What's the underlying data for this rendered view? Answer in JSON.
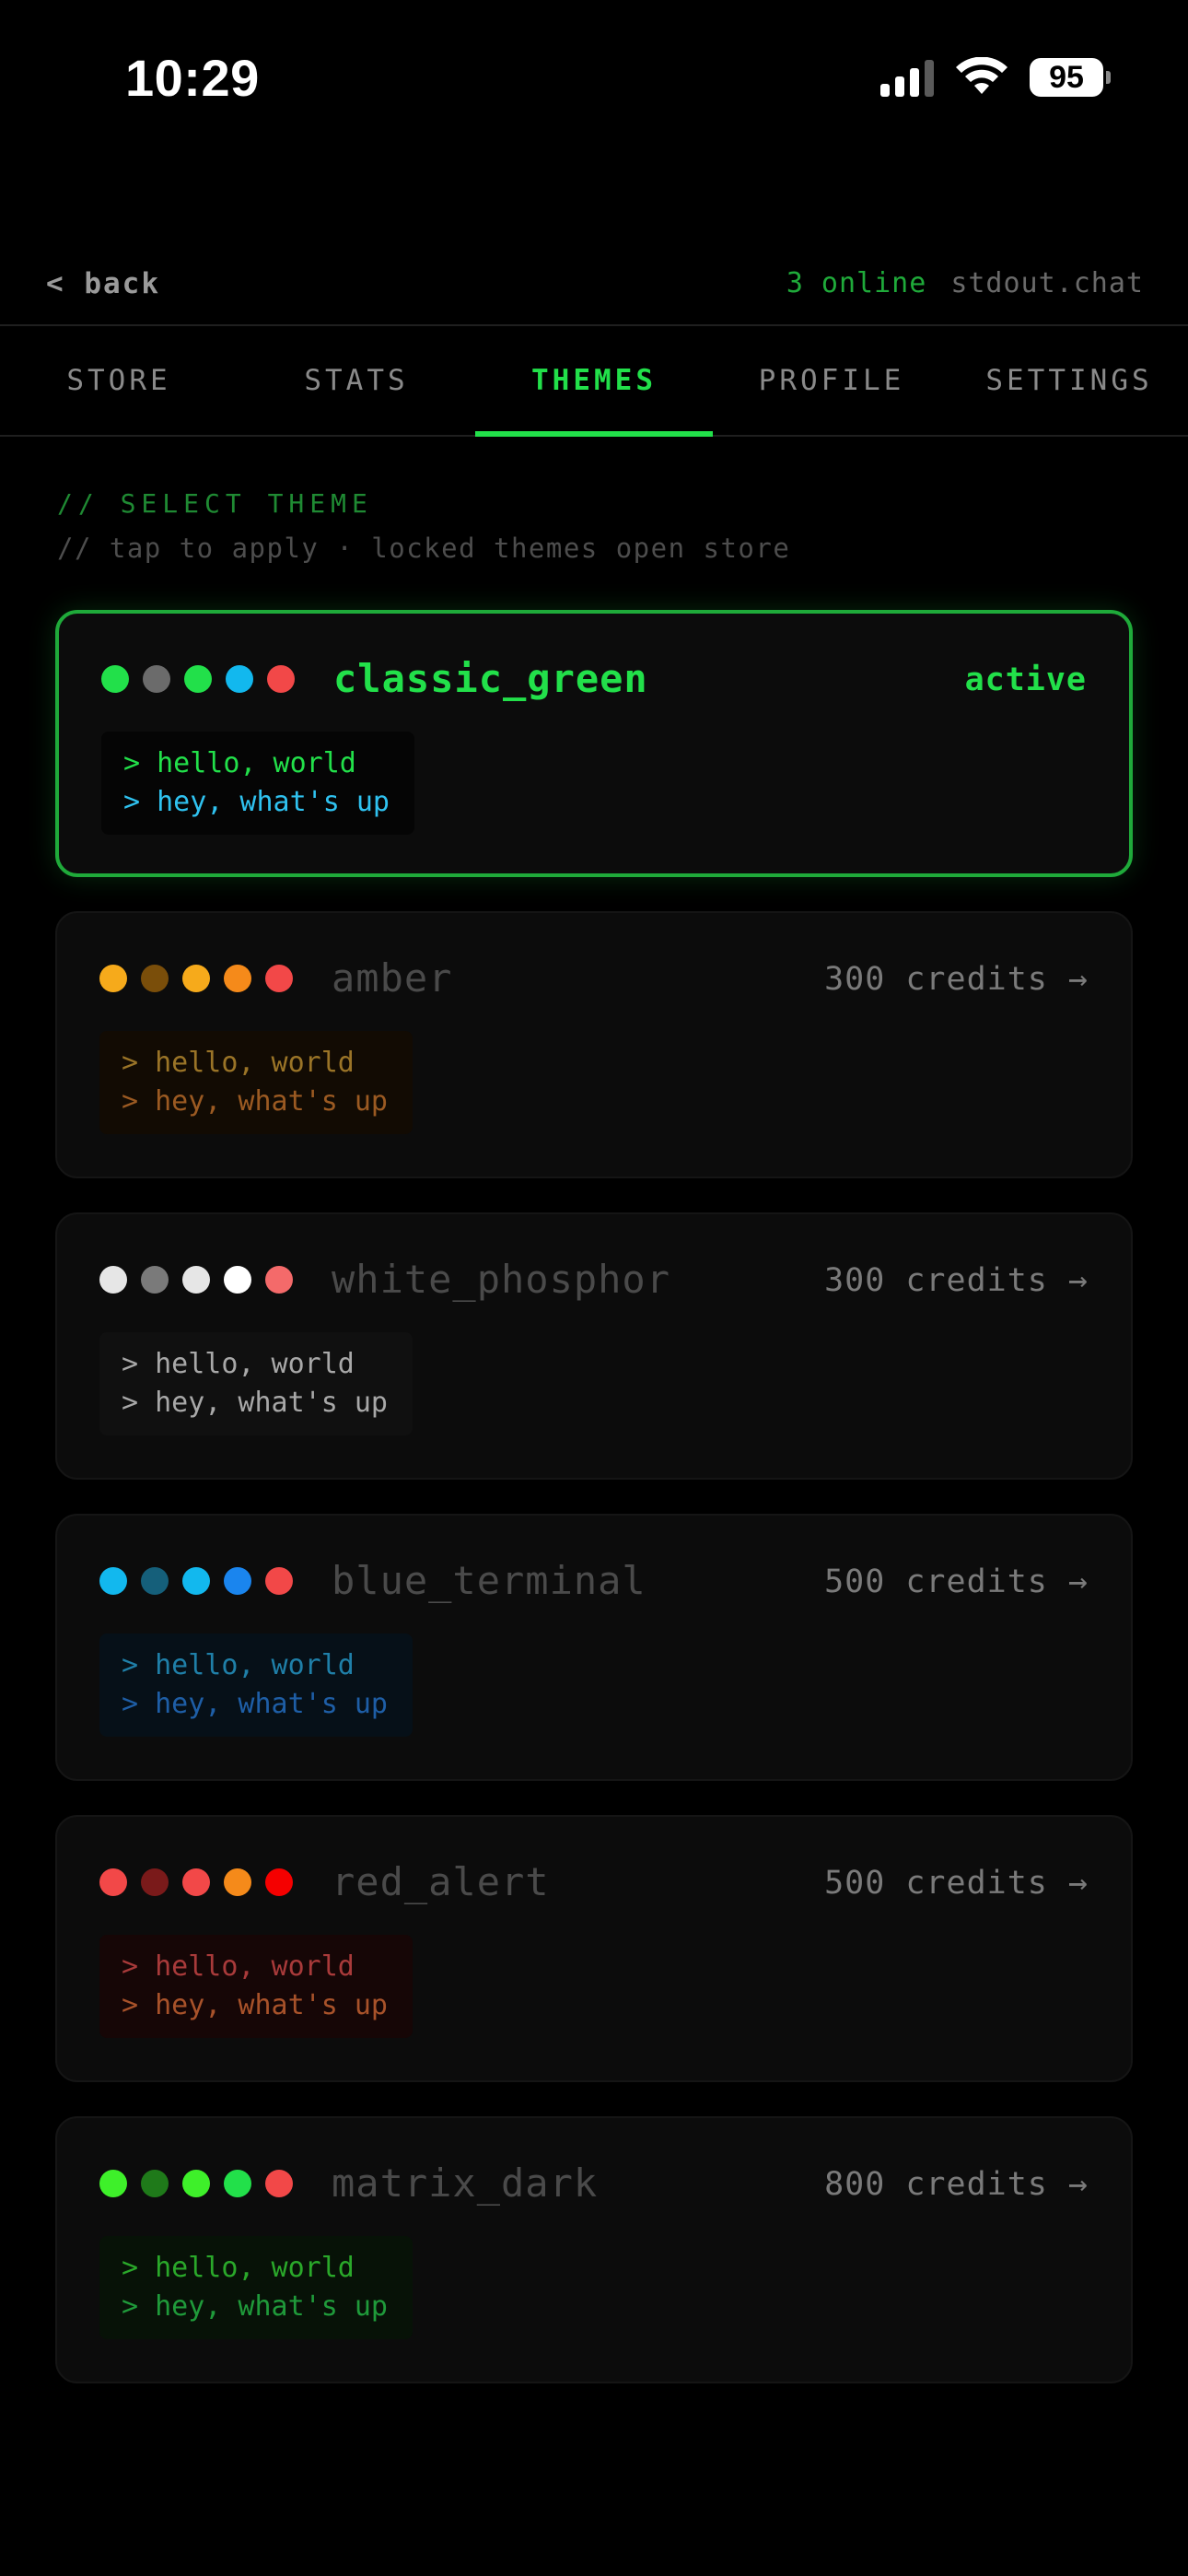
{
  "status": {
    "time": "10:29",
    "battery": "95"
  },
  "nav": {
    "back_label": "< back",
    "online": "3 online",
    "site": "stdout.chat"
  },
  "tabs": [
    {
      "label": "STORE",
      "active": false
    },
    {
      "label": "STATS",
      "active": false
    },
    {
      "label": "THEMES",
      "active": true
    },
    {
      "label": "PROFILE",
      "active": false
    },
    {
      "label": "SETTINGS",
      "active": false
    }
  ],
  "section": {
    "title": "// SELECT THEME",
    "subtitle": "// tap to apply · locked themes open store"
  },
  "themes": [
    {
      "name": "classic_green",
      "action": "active",
      "active": true,
      "dots": [
        "#22e04a",
        "#6b6b6b",
        "#22e04a",
        "#12b8ee",
        "#f24848"
      ],
      "preview_bg": "#050505",
      "line1": "> hello, world",
      "line2": "> hey, what's up",
      "line1_color": "#22e04a",
      "line2_color": "#2fc2f0"
    },
    {
      "name": "amber",
      "action": "300 credits →",
      "active": false,
      "dots": [
        "#f6aa1b",
        "#7a4e0a",
        "#f6aa1b",
        "#f58a1a",
        "#f24848"
      ],
      "preview_bg": "#120b03",
      "line1": "> hello, world",
      "line2": "> hey, what's up",
      "line1_color": "#9a7427",
      "line2_color": "#9b5a22"
    },
    {
      "name": "white_phosphor",
      "action": "300 credits →",
      "active": false,
      "dots": [
        "#e6e6e6",
        "#7a7a7a",
        "#e6e6e6",
        "#ffffff",
        "#f46a6a"
      ],
      "preview_bg": "#101010",
      "line1": "> hello, world",
      "line2": "> hey, what's up",
      "line1_color": "#a8a8a8",
      "line2_color": "#a8a8a8"
    },
    {
      "name": "blue_terminal",
      "action": "500 credits →",
      "active": false,
      "dots": [
        "#12b8ee",
        "#155f7a",
        "#12b8ee",
        "#1a85ee",
        "#f24848"
      ],
      "preview_bg": "#061018",
      "line1": "> hello, world",
      "line2": "> hey, what's up",
      "line1_color": "#1f7fa8",
      "line2_color": "#1e5ea6"
    },
    {
      "name": "red_alert",
      "action": "500 credits →",
      "active": false,
      "dots": [
        "#f24848",
        "#7a1a1a",
        "#f24848",
        "#f58a1a",
        "#f50000"
      ],
      "preview_bg": "#160606",
      "line1": "> hello, world",
      "line2": "> hey, what's up",
      "line1_color": "#a83a3a",
      "line2_color": "#a8522a"
    },
    {
      "name": "matrix_dark",
      "action": "800 credits →",
      "active": false,
      "dots": [
        "#3ef02a",
        "#1f7a1a",
        "#3ef02a",
        "#22e04a",
        "#f24848"
      ],
      "preview_bg": "#071207",
      "line1": "> hello, world",
      "line2": "> hey, what's up",
      "line1_color": "#2aa82a",
      "line2_color": "#1f9a3a"
    }
  ]
}
